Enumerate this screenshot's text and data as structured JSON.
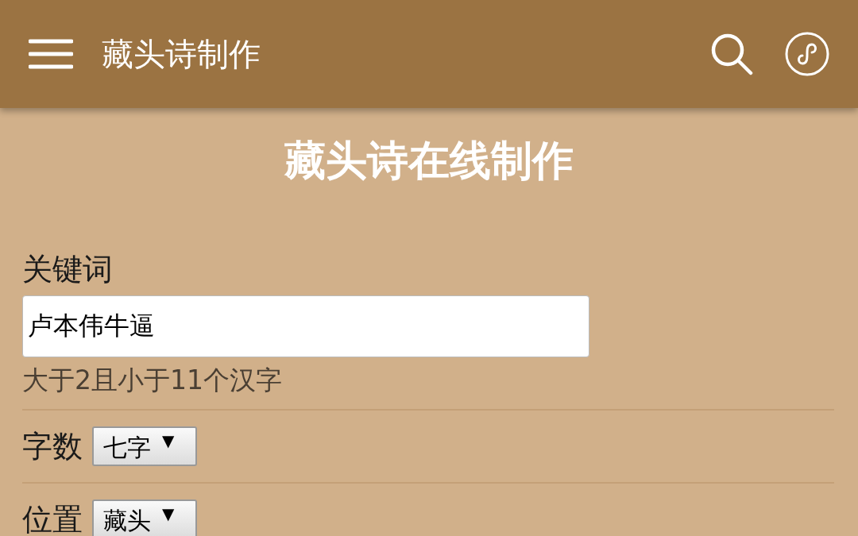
{
  "app_bar": {
    "title": "藏头诗制作"
  },
  "heading": "藏头诗在线制作",
  "keyword": {
    "label": "关键词",
    "value": "卢本伟牛逼",
    "hint": "大于2且小于11个汉字"
  },
  "options": [
    {
      "label": "字数",
      "value": "七字",
      "arrow": "▼"
    },
    {
      "label": "位置",
      "value": "藏头",
      "arrow": "▼"
    }
  ]
}
